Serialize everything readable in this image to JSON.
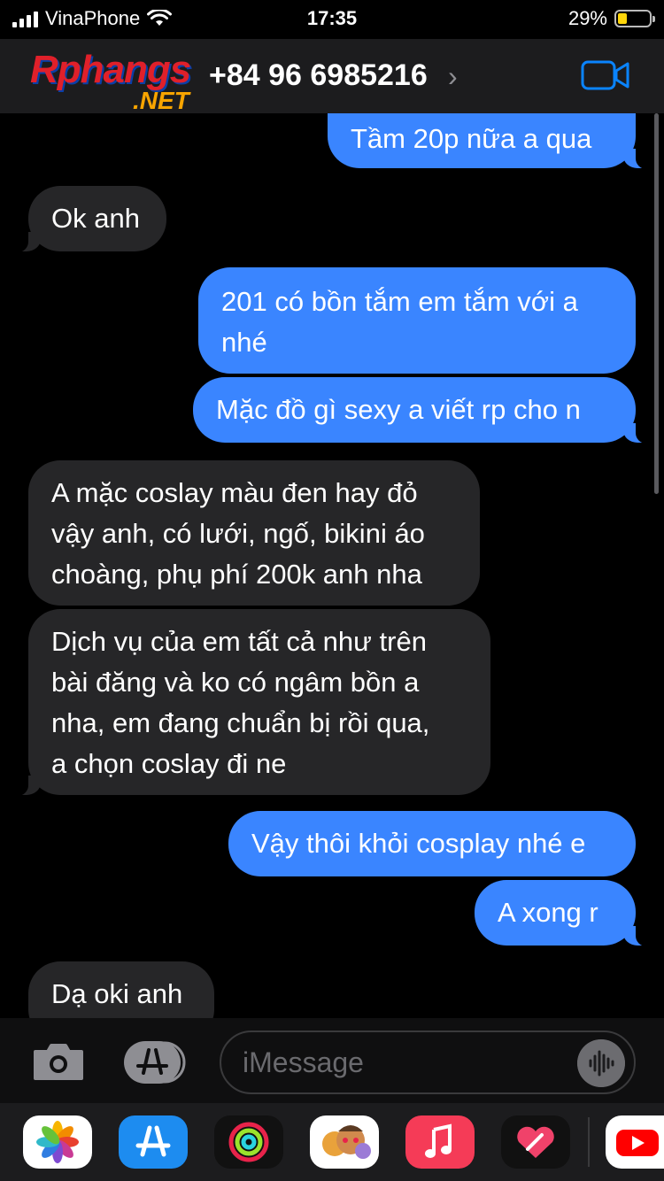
{
  "status_bar": {
    "carrier": "VinaPhone",
    "time": "17:35",
    "battery_percent_label": "29%",
    "battery_level": 0.29
  },
  "header": {
    "watermark_main": "Rphangs",
    "watermark_sub": ".NET",
    "contact_phone": "+84 96 6985216"
  },
  "messages": [
    {
      "direction": "outgoing",
      "text": "Tầm 20p nữa a qua"
    },
    {
      "direction": "incoming",
      "text": "Ok anh"
    },
    {
      "direction": "outgoing",
      "lines": [
        "201 có bồn tắm em tắm với a",
        "nhé"
      ]
    },
    {
      "direction": "outgoing",
      "text": "Mặc đồ gì sexy a viết rp cho n"
    },
    {
      "direction": "incoming",
      "lines": [
        "A mặc coslay màu đen hay đỏ",
        "vậy anh, có lưới, ngố, bikini áo",
        "choàng, phụ phí 200k anh nha"
      ]
    },
    {
      "direction": "incoming",
      "lines": [
        "Dịch vụ của em tất cả như trên",
        "bài đăng và ko có ngâm bồn a",
        "nha, em đang chuẩn bị rồi qua,",
        "a chọn coslay đi ne"
      ]
    },
    {
      "direction": "outgoing",
      "text": "Vậy thôi khỏi cosplay nhé e"
    },
    {
      "direction": "outgoing",
      "text": "A xong r"
    },
    {
      "direction": "incoming",
      "text": "Dạ oki anh"
    }
  ],
  "input": {
    "placeholder": "iMessage"
  },
  "app_drawer": [
    {
      "name": "photos-icon"
    },
    {
      "name": "app-store-icon"
    },
    {
      "name": "activity-icon"
    },
    {
      "name": "memoji-icon"
    },
    {
      "name": "music-icon"
    },
    {
      "name": "digital-touch-icon"
    },
    {
      "name": "youtube-icon"
    }
  ],
  "colors": {
    "outgoing_bubble": "#3a85ff",
    "incoming_bubble": "#262628",
    "background": "#000000",
    "header": "#1c1c1e",
    "accent": "#0a84ff"
  }
}
